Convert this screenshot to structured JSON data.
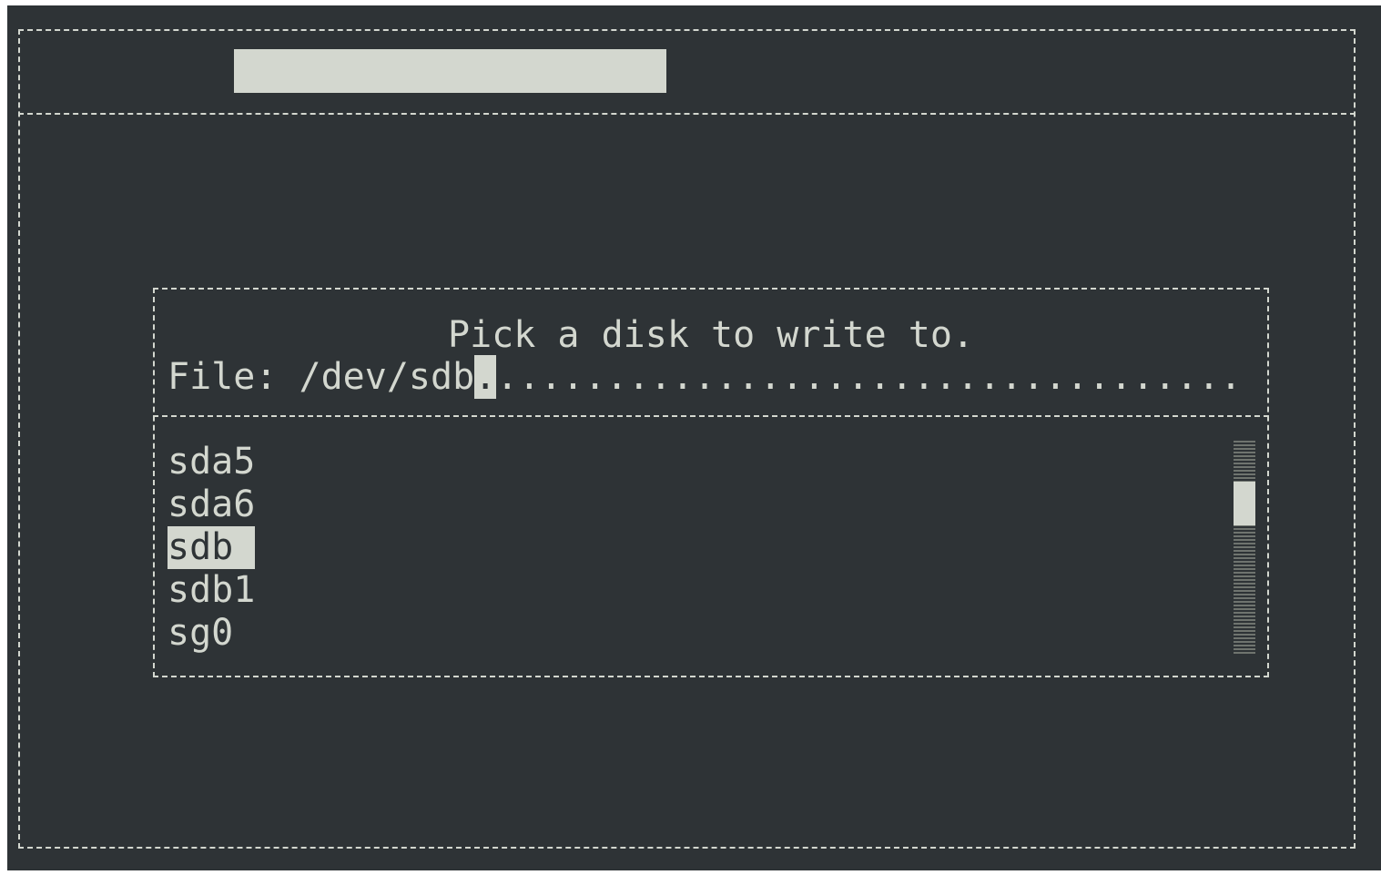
{
  "colors": {
    "background": "#2e3336",
    "foreground": "#d3d7cf",
    "scrollbar_track": "#6f746f"
  },
  "dialog": {
    "prompt": "Pick a disk to write to.",
    "file_label": "File:",
    "file_value": "/dev/sdb",
    "file_cursor_char": ".",
    "file_fill": "........................................................................................................................"
  },
  "list": {
    "items": [
      {
        "label": "sda5",
        "selected": false
      },
      {
        "label": "sda6",
        "selected": false
      },
      {
        "label": "sdb",
        "selected": true
      },
      {
        "label": "sdb1",
        "selected": false
      },
      {
        "label": "sg0",
        "selected": false
      }
    ],
    "scroll_position_fraction": 0.2
  }
}
